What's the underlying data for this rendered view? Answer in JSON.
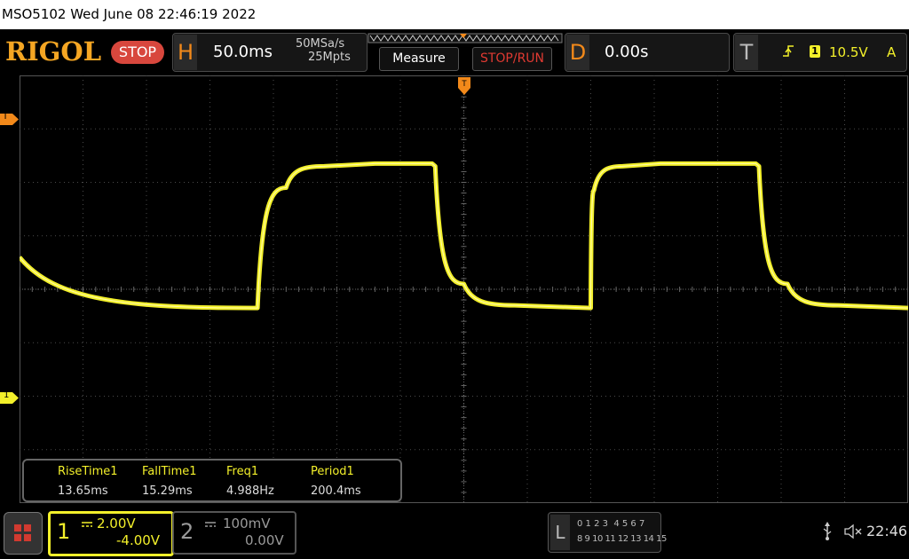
{
  "title_bar": {
    "text": "MSO5102  Wed June 08 22:46:19 2022"
  },
  "logo": "RIGOL",
  "run_state_badge": "STOP",
  "horizontal": {
    "letter": "H",
    "timebase": "50.0ms",
    "sample_rate": "50MSa/s",
    "memory_depth": "25Mpts"
  },
  "buttons": {
    "measure": "Measure",
    "stop_run": "STOP/RUN"
  },
  "delay": {
    "letter": "D",
    "value": "0.00s"
  },
  "trigger": {
    "letter": "T",
    "source": "1",
    "level": "10.5V",
    "mode": "A"
  },
  "side_markers": {
    "trigger_level": "T",
    "channel1_ground": "1"
  },
  "measurements": {
    "items": [
      {
        "label": "RiseTime1",
        "value": "13.65ms"
      },
      {
        "label": "FallTime1",
        "value": "15.29ms"
      },
      {
        "label": "Freq1",
        "value": "4.988Hz"
      },
      {
        "label": "Period1",
        "value": "200.4ms"
      }
    ]
  },
  "channel1": {
    "number": "1",
    "scale": "2.00V",
    "offset": "-4.00V"
  },
  "channel2": {
    "number": "2",
    "scale": "100mV",
    "offset": "0.00V"
  },
  "logic": {
    "letter": "L",
    "row1": "0 1 2 3  4 5 6 7",
    "row2": "8 9 10 11 12 13 14 15"
  },
  "status": {
    "time": "22:46"
  },
  "colors": {
    "ch1": "#f3f02a",
    "accent": "#f2891a",
    "stop": "#d8473d",
    "grid": "#4a4a4a"
  },
  "chart_data": {
    "type": "line",
    "title": "",
    "xlabel": "",
    "ylabel": "",
    "grid": true,
    "x_divisions": 14,
    "y_divisions": 8,
    "series": [
      {
        "x": [
          0,
          3.7,
          3.75,
          4.2,
          4.8,
          5.6,
          6.5,
          6.55,
          7.0,
          7.8,
          9.0,
          9.05,
          9.5,
          10.1,
          11.6,
          11.65,
          12.1,
          12.9,
          14.0
        ],
        "y": [
          0.6,
          -0.35,
          -0.35,
          1.9,
          2.3,
          2.35,
          2.35,
          2.3,
          0.1,
          -0.3,
          -0.35,
          1.85,
          2.3,
          2.35,
          2.35,
          2.3,
          0.1,
          -0.3,
          -0.35
        ]
      }
    ]
  }
}
